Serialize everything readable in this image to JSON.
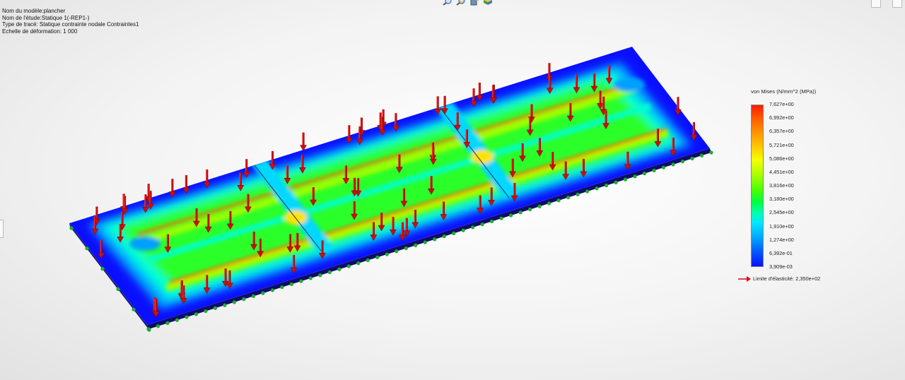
{
  "study_info": {
    "model_name": "Nom du modèle:plancher",
    "study_name": "Nom de l'étude:Statique 1(-REP1-)",
    "plot_type": "Type de tracé: Statique contrainte nodale Contraintes1",
    "deformation_scale": "Echelle de déformation: 1 000"
  },
  "toolbar": {
    "icons": [
      "zoom-to-fit-icon",
      "zoom-to-area-icon",
      "view-orientation-icon",
      "display-style-icon"
    ]
  },
  "legend": {
    "title": "von Mises (N/mm^2 (MPa))",
    "ticks": [
      "7,627e+00",
      "6,992e+00",
      "6,357e+00",
      "5,721e+00",
      "5,086e+00",
      "4,451e+00",
      "3,816e+00",
      "3,180e+00",
      "2,545e+00",
      "1,910e+00",
      "1,274e+00",
      "6,392e-01",
      "3,909e-03"
    ],
    "yield_label": "Limite d'élasticité: 2,350e+02",
    "yield_color": "#e3000f"
  },
  "colors": {
    "low_stress": "#0a10ff",
    "high_stress": "#ff1a00",
    "load_arrow": "#cc0f0f",
    "fixture": "#1fae2c"
  }
}
